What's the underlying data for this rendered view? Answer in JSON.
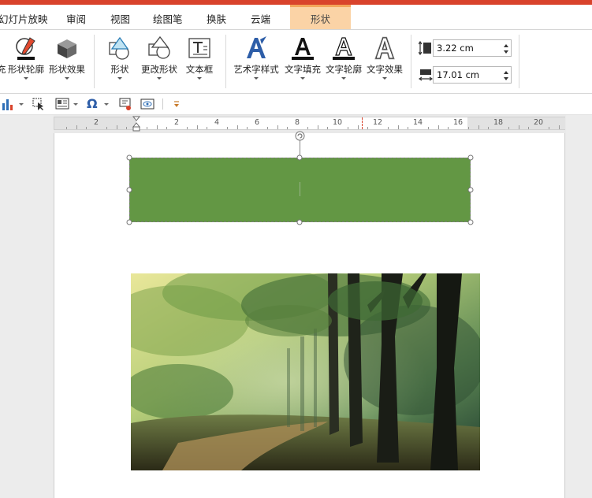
{
  "tabs": [
    {
      "label": "幻灯片放映"
    },
    {
      "label": "审阅"
    },
    {
      "label": "视图"
    },
    {
      "label": "绘图笔"
    },
    {
      "label": "换肤"
    },
    {
      "label": "云端"
    },
    {
      "label": "形状"
    }
  ],
  "ribbon": {
    "left_cut": "充",
    "buttons": [
      {
        "label": "形状轮廓",
        "icon": "pencil-outline-icon"
      },
      {
        "label": "形状效果",
        "icon": "cube-effect-icon"
      },
      {
        "label": "形状",
        "icon": "shapes-icon"
      },
      {
        "label": "更改形状",
        "icon": "change-shape-icon"
      },
      {
        "label": "文本框",
        "icon": "textbox-icon"
      },
      {
        "label": "艺术字样式",
        "icon": "wordart-style-icon"
      },
      {
        "label": "文字填充",
        "icon": "text-fill-icon"
      },
      {
        "label": "文字轮廓",
        "icon": "text-outline-icon"
      },
      {
        "label": "文字效果",
        "icon": "text-effect-icon"
      }
    ],
    "height_value": "3.22 cm",
    "width_value": "17.01 cm"
  },
  "quickbar": {
    "icons": [
      "chart-icon",
      "select-icon",
      "layout-icon",
      "omega-symbol-icon",
      "slide-icon",
      "preview-icon",
      "customize-icon"
    ],
    "omega_glyph": "Ω"
  },
  "ruler": {
    "labels": [
      "2",
      "2",
      "4",
      "6",
      "8",
      "10",
      "12",
      "14",
      "16",
      "18",
      "20"
    ]
  },
  "colors": {
    "accent_red": "#d9432c",
    "active_tab": "#fbd3a6",
    "shape_fill": "#639744"
  }
}
